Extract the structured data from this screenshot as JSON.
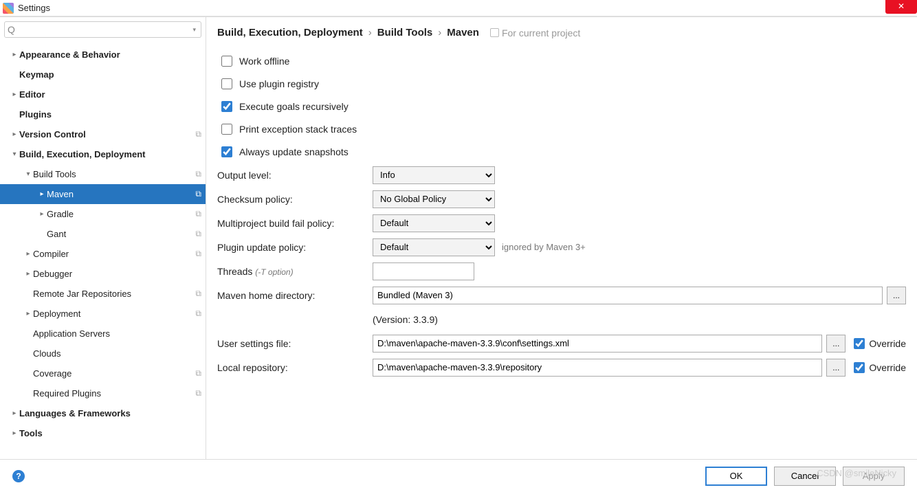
{
  "window": {
    "title": "Settings"
  },
  "search": {
    "placeholder": ""
  },
  "tree": [
    {
      "label": "Appearance & Behavior",
      "lvl": 0,
      "arrow": "right",
      "bold": true,
      "badge": ""
    },
    {
      "label": "Keymap",
      "lvl": 0,
      "arrow": "none",
      "bold": true,
      "badge": ""
    },
    {
      "label": "Editor",
      "lvl": 0,
      "arrow": "right",
      "bold": true,
      "badge": ""
    },
    {
      "label": "Plugins",
      "lvl": 0,
      "arrow": "none",
      "bold": true,
      "badge": ""
    },
    {
      "label": "Version Control",
      "lvl": 0,
      "arrow": "right",
      "bold": true,
      "badge": "⧉"
    },
    {
      "label": "Build, Execution, Deployment",
      "lvl": 0,
      "arrow": "down",
      "bold": true,
      "badge": ""
    },
    {
      "label": "Build Tools",
      "lvl": 1,
      "arrow": "down",
      "bold": false,
      "badge": "⧉"
    },
    {
      "label": "Maven",
      "lvl": 2,
      "arrow": "right",
      "bold": false,
      "badge": "⧉",
      "selected": true
    },
    {
      "label": "Gradle",
      "lvl": 2,
      "arrow": "right",
      "bold": false,
      "badge": "⧉"
    },
    {
      "label": "Gant",
      "lvl": 2,
      "arrow": "none",
      "bold": false,
      "badge": "⧉"
    },
    {
      "label": "Compiler",
      "lvl": 1,
      "arrow": "right",
      "bold": false,
      "badge": "⧉"
    },
    {
      "label": "Debugger",
      "lvl": 1,
      "arrow": "right",
      "bold": false,
      "badge": ""
    },
    {
      "label": "Remote Jar Repositories",
      "lvl": 1,
      "arrow": "none",
      "bold": false,
      "badge": "⧉"
    },
    {
      "label": "Deployment",
      "lvl": 1,
      "arrow": "right",
      "bold": false,
      "badge": "⧉"
    },
    {
      "label": "Application Servers",
      "lvl": 1,
      "arrow": "none",
      "bold": false,
      "badge": ""
    },
    {
      "label": "Clouds",
      "lvl": 1,
      "arrow": "none",
      "bold": false,
      "badge": ""
    },
    {
      "label": "Coverage",
      "lvl": 1,
      "arrow": "none",
      "bold": false,
      "badge": "⧉"
    },
    {
      "label": "Required Plugins",
      "lvl": 1,
      "arrow": "none",
      "bold": false,
      "badge": "⧉"
    },
    {
      "label": "Languages & Frameworks",
      "lvl": 0,
      "arrow": "right",
      "bold": true,
      "badge": ""
    },
    {
      "label": "Tools",
      "lvl": 0,
      "arrow": "right",
      "bold": true,
      "badge": ""
    }
  ],
  "breadcrumb": {
    "seg1": "Build, Execution, Deployment",
    "seg2": "Build Tools",
    "seg3": "Maven",
    "hint": "For current project"
  },
  "checks": {
    "work_offline": "Work offline",
    "use_plugin_registry": "Use plugin registry",
    "execute_recursive": "Execute goals recursively",
    "print_exception": "Print exception stack traces",
    "always_update": "Always update snapshots"
  },
  "labels": {
    "output_level": "Output level:",
    "checksum": "Checksum policy:",
    "multiproject": "Multiproject build fail policy:",
    "plugin_update": "Plugin update policy:",
    "plugin_note": "ignored by Maven 3+",
    "threads": "Threads",
    "threads_hint": "(-T option)",
    "maven_home": "Maven home directory:",
    "version": "(Version: 3.3.9)",
    "user_settings": "User settings file:",
    "local_repo": "Local repository:",
    "override": "Override"
  },
  "values": {
    "output_level": "Info",
    "checksum": "No Global Policy",
    "multiproject": "Default",
    "plugin_update": "Default",
    "threads": "",
    "maven_home": "Bundled (Maven 3)",
    "user_settings": "D:\\maven\\apache-maven-3.3.9\\conf\\settings.xml",
    "local_repo": "D:\\maven\\apache-maven-3.3.9\\repository"
  },
  "footer": {
    "ok": "OK",
    "cancel": "Cancel",
    "apply": "Apply"
  },
  "watermark": "CSDN @smileNicky"
}
